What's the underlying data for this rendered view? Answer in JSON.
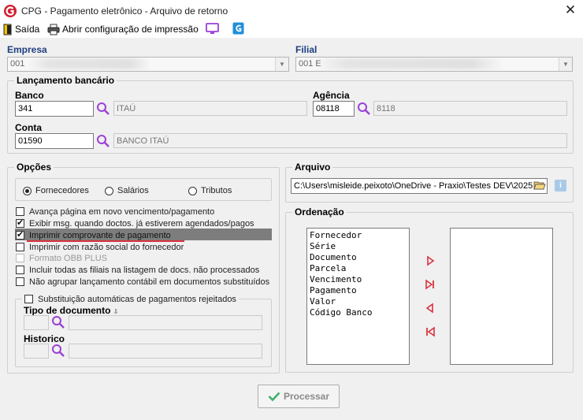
{
  "window": {
    "title": "CPG - Pagamento eletrônico - Arquivo de retorno",
    "close_label": "✕"
  },
  "toolbar": {
    "exit_label": "Saída",
    "print_config_label": "Abrir configuração de impressão"
  },
  "empresa": {
    "label": "Empresa",
    "value": "001"
  },
  "filial": {
    "label": "Filial",
    "value": "001 E"
  },
  "lancamento": {
    "legend": "Lançamento bancário",
    "banco_label": "Banco",
    "banco_value": "341",
    "banco_name": "ITAÚ",
    "agencia_label": "Agência",
    "agencia_value": "08118",
    "agencia_name": "8118",
    "conta_label": "Conta",
    "conta_value": "01590",
    "conta_name": "BANCO ITAÚ"
  },
  "opcoes": {
    "legend": "Opções",
    "radios": [
      {
        "label": "Fornecedores",
        "selected": true
      },
      {
        "label": "Salários",
        "selected": false
      },
      {
        "label": "Tributos",
        "selected": false
      }
    ],
    "checkboxes": [
      {
        "label": "Avança página em novo vencimento/pagamento",
        "checked": false,
        "disabled": false
      },
      {
        "label": "Exibir msg. quando doctos. já estiverem agendados/pagos",
        "checked": true,
        "disabled": false
      },
      {
        "label": "Imprimir comprovante de pagamento",
        "checked": true,
        "disabled": false
      },
      {
        "label": "Imprimir com razão social do fornecedor",
        "checked": false,
        "disabled": false
      },
      {
        "label": "Formato OBB PLUS",
        "checked": false,
        "disabled": true
      },
      {
        "label": "Incluir todas as filiais na listagem de docs. não processados",
        "checked": false,
        "disabled": false
      },
      {
        "label": "Não agrupar lançamento contábil em documentos substituídos",
        "checked": false,
        "disabled": false
      }
    ],
    "substituicao_label": "Substituição automáticas de pagamentos rejeitados",
    "tipo_documento_label": "Tipo de documento",
    "historico_label": "Historico"
  },
  "arquivo": {
    "legend": "Arquivo",
    "path": "C:\\Users\\misleide.peixoto\\OneDrive - Praxio\\Testes DEV\\2025",
    "info_label": "i"
  },
  "ordenacao": {
    "legend": "Ordenação",
    "items": [
      "Fornecedor",
      "Série",
      "Documento",
      "Parcela",
      "Vencimento",
      "Pagamento",
      "Valor",
      "Código Banco"
    ]
  },
  "process_button": {
    "label": "Processar"
  },
  "colors": {
    "brand_red": "#d0202f",
    "accent_purple": "#9b3fd6",
    "arrow_red": "#d9323f"
  }
}
